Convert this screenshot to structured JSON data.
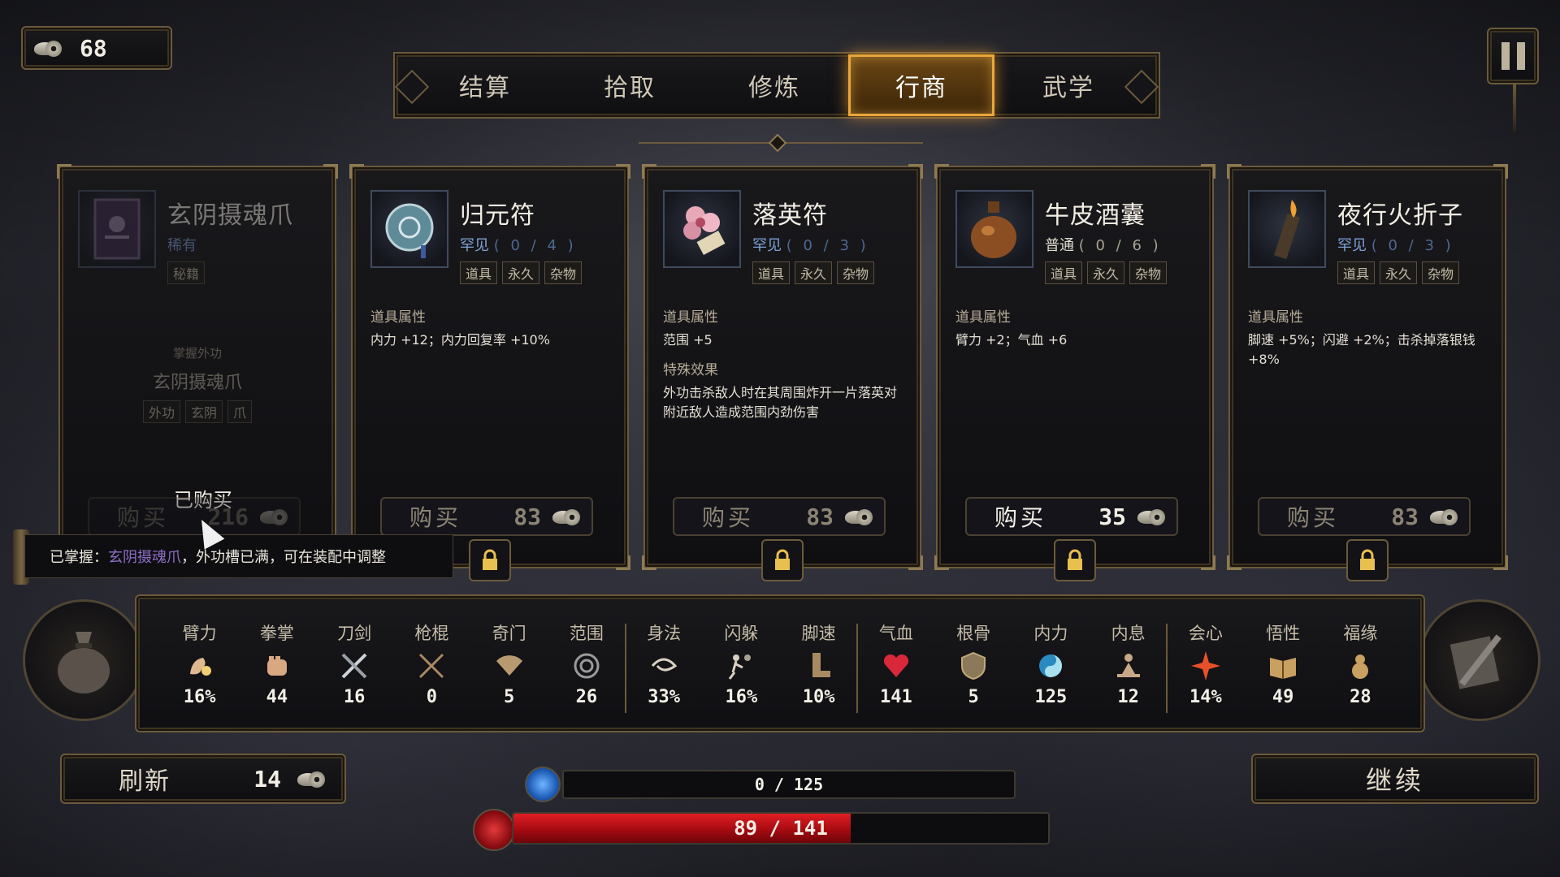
{
  "currency": {
    "value": "68",
    "icon": "coin-icon"
  },
  "tabs": [
    {
      "label": "结算",
      "active": false
    },
    {
      "label": "拾取",
      "active": false
    },
    {
      "label": "修炼",
      "active": false
    },
    {
      "label": "行商",
      "active": true
    },
    {
      "label": "武学",
      "active": false
    }
  ],
  "cards": [
    {
      "name": "玄阴摄魂爪",
      "rarity": "稀有",
      "tags": [
        "秘籍"
      ],
      "mastery_label": "掌握外功",
      "mastery_name": "玄阴摄魂爪",
      "mastery_tags": [
        "外功",
        "玄阴",
        "爪"
      ],
      "purchased_label": "已购买",
      "buy_label": "购买",
      "price": "216",
      "icon": "book-icon"
    },
    {
      "name": "归元符",
      "rarity": "罕见",
      "count": "( 0 / 4 )",
      "tags": [
        "道具",
        "永久",
        "杂物"
      ],
      "section1_title": "道具属性",
      "section1_text": "内力 +12；内力回复率 +10%",
      "buy_label": "购买",
      "price": "83",
      "icon": "jade-disc-icon"
    },
    {
      "name": "落英符",
      "rarity": "罕见",
      "count": "( 0 / 3 )",
      "tags": [
        "道具",
        "永久",
        "杂物"
      ],
      "section1_title": "道具属性",
      "section1_text": "范围 +5",
      "section2_title": "特殊效果",
      "section2_text": "外功击杀敌人时在其周围炸开一片落英对附近敌人造成范围内劲伤害",
      "buy_label": "购买",
      "price": "83",
      "icon": "blossom-icon"
    },
    {
      "name": "牛皮酒囊",
      "rarity": "普通",
      "count": "( 0 / 6 )",
      "tags": [
        "道具",
        "永久",
        "杂物"
      ],
      "section1_title": "道具属性",
      "section1_text": "臂力 +2；气血 +6",
      "buy_label": "购买",
      "price": "35",
      "icon": "wine-gourd-icon"
    },
    {
      "name": "夜行火折子",
      "rarity": "罕见",
      "count": "( 0 / 3 )",
      "tags": [
        "道具",
        "永久",
        "杂物"
      ],
      "section1_title": "道具属性",
      "section1_text": "脚速 +5%；闪避 +2%；击杀掉落银钱 +8%",
      "buy_label": "购买",
      "price": "83",
      "icon": "torch-icon"
    }
  ],
  "tooltip": {
    "prefix": "已掌握：",
    "highlight": "玄阴摄魂爪",
    "suffix": "，外功槽已满，可在装配中调整"
  },
  "stats": [
    {
      "name": "臂力",
      "value": "16%",
      "icon": "arm-icon"
    },
    {
      "name": "拳掌",
      "value": "44",
      "icon": "fist-icon"
    },
    {
      "name": "刀剑",
      "value": "16",
      "icon": "crossed-swords-icon"
    },
    {
      "name": "枪棍",
      "value": "0",
      "icon": "crossed-spears-icon"
    },
    {
      "name": "奇门",
      "value": "5",
      "icon": "fan-icon"
    },
    {
      "name": "范围",
      "value": "26",
      "icon": "ring-icon"
    },
    {
      "name": "身法",
      "value": "33%",
      "icon": "swirl-icon"
    },
    {
      "name": "闪躲",
      "value": "16%",
      "icon": "dodge-icon"
    },
    {
      "name": "脚速",
      "value": "10%",
      "icon": "boot-icon"
    },
    {
      "name": "气血",
      "value": "141",
      "icon": "heart-icon"
    },
    {
      "name": "根骨",
      "value": "5",
      "icon": "shield-icon"
    },
    {
      "name": "内力",
      "value": "125",
      "icon": "yin-yang-icon"
    },
    {
      "name": "内息",
      "value": "12",
      "icon": "meditate-icon"
    },
    {
      "name": "会心",
      "value": "14%",
      "icon": "burst-icon"
    },
    {
      "name": "悟性",
      "value": "49",
      "icon": "book-open-icon"
    },
    {
      "name": "福缘",
      "value": "28",
      "icon": "gourd-icon"
    }
  ],
  "bottom": {
    "refresh_label": "刷新",
    "refresh_cost": "14",
    "continue_label": "继续",
    "mp_text": "0 / 125",
    "mp_fraction": 0,
    "hp_text": "89 / 141",
    "hp_fraction": 0.631
  },
  "colors": {
    "accent": "#e9a73a",
    "rare": "#7da2d8",
    "hp": "#e21d24",
    "mp": "#1e5db8"
  }
}
